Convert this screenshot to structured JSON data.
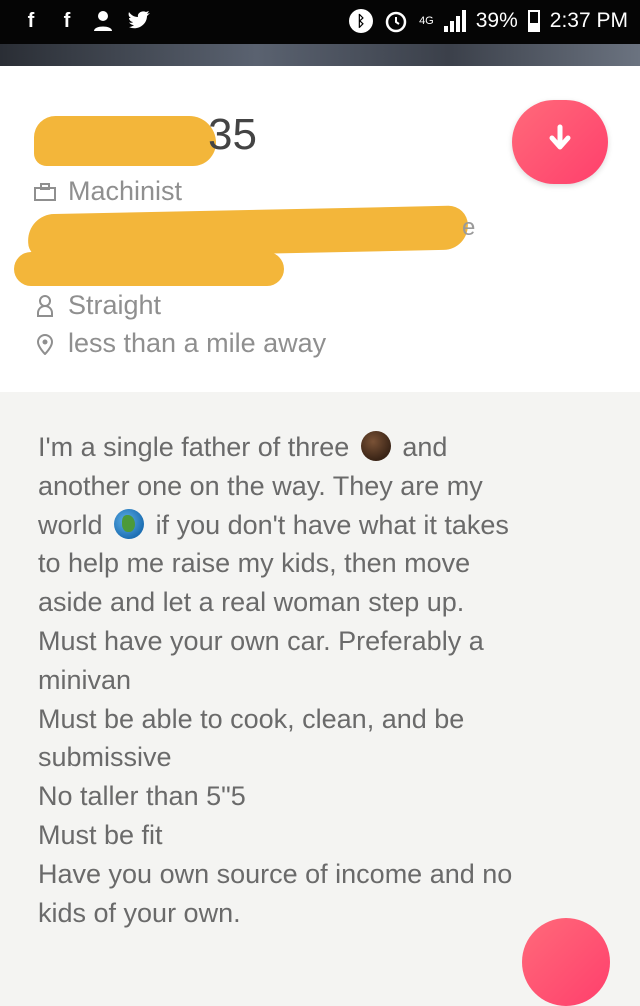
{
  "status_bar": {
    "left_icons": [
      "facebook-icon",
      "facebook-icon",
      "profile-notification-icon",
      "twitter-icon"
    ],
    "battery": "39%",
    "time": "2:37 PM",
    "network": "4G"
  },
  "profile": {
    "age": "35",
    "job": "Machinist",
    "redacted_fragment": "e",
    "orientation": "Straight",
    "distance": "less than a mile away"
  },
  "bio": {
    "lines": [
      "I'm a single father of three",
      "and",
      "another one on the way. They are my",
      "world",
      "if you don't have what it takes",
      "to help me raise my kids, then move",
      "aside and let a real woman step up.",
      "Must have your own car. Preferably a",
      "minivan",
      "Must be able to cook, clean, and be",
      "submissive",
      "No taller than 5\"5",
      "Must be fit",
      "Have you own source of income and no",
      "kids of your own."
    ]
  },
  "colors": {
    "accent": "#ff4f70",
    "redaction": "#f3b63a",
    "text": "#6a6a6a"
  }
}
